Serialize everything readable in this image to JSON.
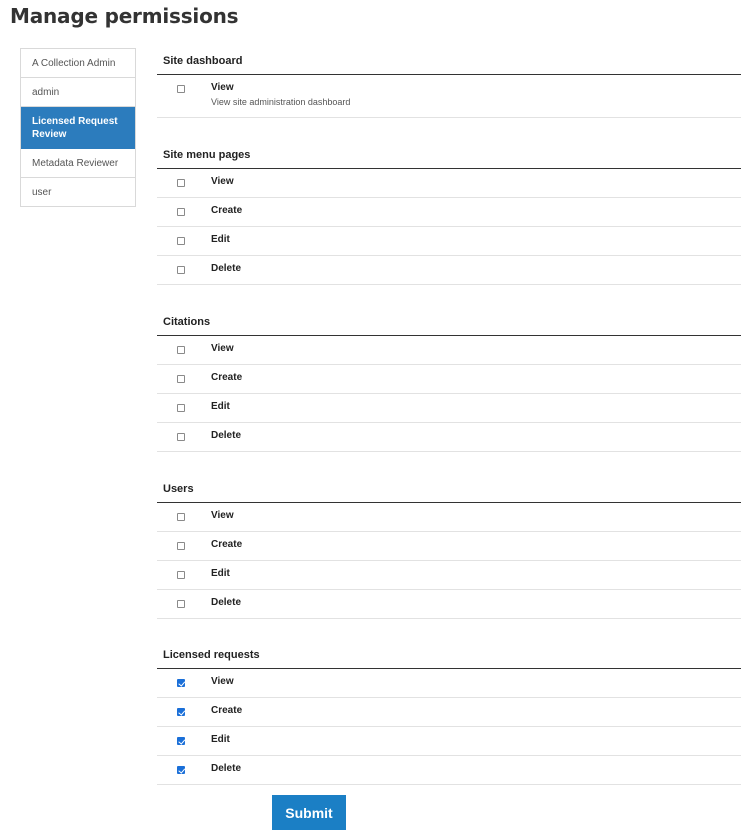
{
  "page": {
    "title": "Manage permissions"
  },
  "roles": [
    {
      "label": "A Collection Admin",
      "active": false
    },
    {
      "label": "admin",
      "active": false
    },
    {
      "label": "Licensed Request Review",
      "active": true
    },
    {
      "label": "Metadata Reviewer",
      "active": false
    },
    {
      "label": "user",
      "active": false
    }
  ],
  "sections": [
    {
      "title": "Site dashboard",
      "permissions": [
        {
          "label": "View",
          "description": "View site administration dashboard",
          "checked": false
        }
      ]
    },
    {
      "title": "Site menu pages",
      "permissions": [
        {
          "label": "View",
          "checked": false
        },
        {
          "label": "Create",
          "checked": false
        },
        {
          "label": "Edit",
          "checked": false
        },
        {
          "label": "Delete",
          "checked": false
        }
      ]
    },
    {
      "title": "Citations",
      "permissions": [
        {
          "label": "View",
          "checked": false
        },
        {
          "label": "Create",
          "checked": false
        },
        {
          "label": "Edit",
          "checked": false
        },
        {
          "label": "Delete",
          "checked": false
        }
      ]
    },
    {
      "title": "Users",
      "permissions": [
        {
          "label": "View",
          "checked": false
        },
        {
          "label": "Create",
          "checked": false
        },
        {
          "label": "Edit",
          "checked": false
        },
        {
          "label": "Delete",
          "checked": false
        }
      ]
    },
    {
      "title": "Licensed requests",
      "permissions": [
        {
          "label": "View",
          "checked": true
        },
        {
          "label": "Create",
          "checked": true
        },
        {
          "label": "Edit",
          "checked": true
        },
        {
          "label": "Delete",
          "checked": true
        }
      ]
    }
  ],
  "form": {
    "submit_label": "Submit"
  },
  "colors": {
    "active_role": "#2c7cbd",
    "submit": "#1b7fc5",
    "checkbox_checked": "#1a6fd8"
  }
}
